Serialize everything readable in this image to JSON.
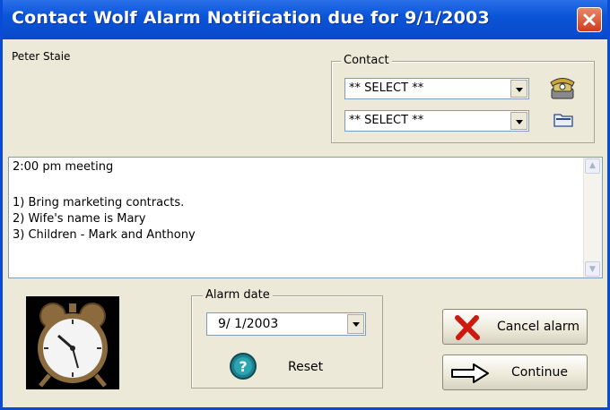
{
  "window": {
    "title": "Contact Wolf Alarm Notification due for 9/1/2003"
  },
  "contact_name": "Peter Staie",
  "contact_group": {
    "legend": "Contact",
    "select1": "** SELECT **",
    "select2": "** SELECT **"
  },
  "notes": {
    "lines": [
      "2:00 pm meeting",
      "1) Bring marketing contracts.",
      "2) Wife's name is Mary",
      "3) Children - Mark and Anthony"
    ]
  },
  "alarm_group": {
    "legend": "Alarm date",
    "date_value": "9/ 1/2003",
    "reset_label": "Reset"
  },
  "buttons": {
    "cancel_label": "Cancel alarm",
    "continue_label": "Continue"
  },
  "icons": [
    "close-icon",
    "phone-icon",
    "folder-icon",
    "alarm-clock-icon",
    "help-icon",
    "red-x-icon",
    "right-arrow-icon"
  ],
  "colors": {
    "titlebar": "#0a55d8",
    "window_bg": "#ece9d8",
    "cancel_x": "#cc1a10"
  }
}
